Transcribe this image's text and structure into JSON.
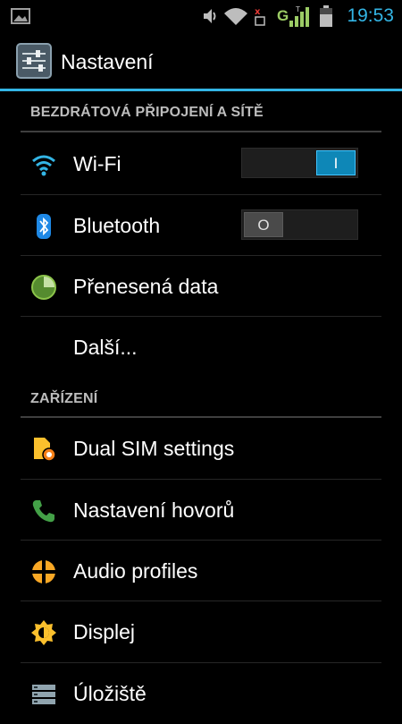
{
  "status_bar": {
    "time": "19:53",
    "network_type": "G",
    "icons": [
      "gallery-icon",
      "volume-icon",
      "wifi-signal-icon",
      "sim-no-signal-icon",
      "cell-signal-icon",
      "battery-icon"
    ]
  },
  "header": {
    "title": "Nastavení",
    "icon": "settings-sliders-icon"
  },
  "sections": [
    {
      "label": "BEZDRÁTOVÁ PŘIPOJENÍ A SÍTĚ",
      "items": [
        {
          "label": "Wi-Fi",
          "icon": "wifi-icon",
          "toggle": "I",
          "toggle_state": "on"
        },
        {
          "label": "Bluetooth",
          "icon": "bluetooth-icon",
          "toggle": "O",
          "toggle_state": "off"
        },
        {
          "label": "Přenesená data",
          "icon": "data-usage-icon"
        },
        {
          "label": "Další..."
        }
      ]
    },
    {
      "label": "ZAŘÍZENÍ",
      "items": [
        {
          "label": "Dual SIM settings",
          "icon": "dual-sim-icon"
        },
        {
          "label": "Nastavení hovorů",
          "icon": "phone-icon"
        },
        {
          "label": "Audio profiles",
          "icon": "audio-profiles-icon"
        },
        {
          "label": "Displej",
          "icon": "display-brightness-icon"
        },
        {
          "label": "Úložiště",
          "icon": "storage-icon"
        }
      ]
    }
  ],
  "colors": {
    "accent": "#33b5e5",
    "background": "#000000"
  }
}
